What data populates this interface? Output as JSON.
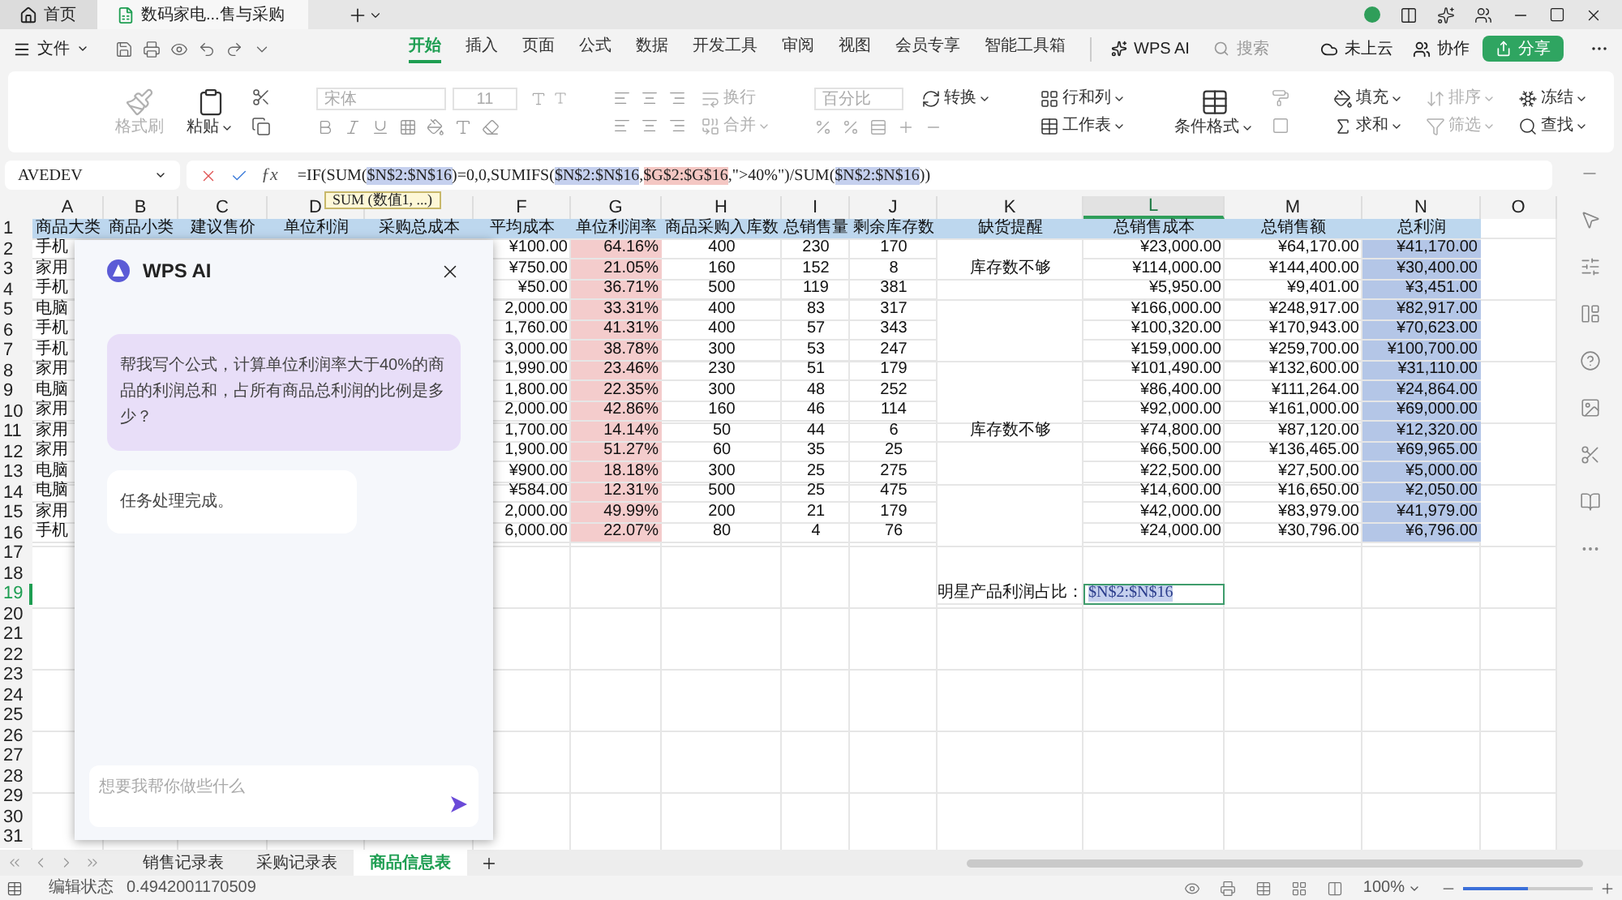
{
  "doc_tabs": [
    {
      "label": "首页",
      "kind": "home",
      "selected": false
    },
    {
      "label": "数码家电...售与采购",
      "kind": "sheet",
      "selected": true
    }
  ],
  "menu": {
    "file": "文件",
    "tabs": [
      {
        "label": "开始",
        "selected": true
      },
      {
        "label": "插入",
        "selected": false
      },
      {
        "label": "页面",
        "selected": false
      },
      {
        "label": "公式",
        "selected": false
      },
      {
        "label": "数据",
        "selected": false
      },
      {
        "label": "开发工具",
        "selected": false
      },
      {
        "label": "审阅",
        "selected": false
      },
      {
        "label": "视图",
        "selected": false
      },
      {
        "label": "会员专享",
        "selected": false
      },
      {
        "label": "智能工具箱",
        "selected": false
      }
    ],
    "ai": "WPS AI",
    "search": {
      "placeholder": "搜索"
    },
    "cloud": "未上云",
    "collab": "协作",
    "share": "分享"
  },
  "ribbon": {
    "format_painter": {
      "label": "格式刷",
      "disabled": true
    },
    "paste": {
      "label": "粘贴",
      "disabled": false
    },
    "font": {
      "label": "宋体",
      "disabled": true
    },
    "font_size": {
      "label": "11",
      "disabled": true
    },
    "wrap": {
      "label": "换行",
      "disabled": true
    },
    "merge": {
      "label": "合并",
      "disabled": true
    },
    "number_format": {
      "label": "百分比",
      "disabled": true
    },
    "convert": {
      "label": "转换",
      "disabled": false
    },
    "rows_cols": {
      "label": "行和列",
      "disabled": false
    },
    "worksheet": {
      "label": "工作表",
      "disabled": false
    },
    "cond_format": {
      "label": "条件格式",
      "disabled": false
    },
    "fill": {
      "label": "填充",
      "disabled": false
    },
    "sort": {
      "label": "排序",
      "disabled": true
    },
    "freeze": {
      "label": "冻结",
      "disabled": false
    },
    "sum": {
      "label": "求和",
      "disabled": false
    },
    "filter": {
      "label": "筛选",
      "disabled": true
    },
    "find": {
      "label": "查找",
      "disabled": false
    }
  },
  "formula_bar": {
    "name_box": "AVEDEV",
    "fx": "ƒx",
    "parts": [
      {
        "text": "=IF(SUM("
      },
      {
        "text": "$N$2:$N$16",
        "color": "#c5d0ee"
      },
      {
        "text": ")=0,0,SUMIFS("
      },
      {
        "text": "$N$2:$N$16",
        "color": "#c5d0ee"
      },
      {
        "text": ","
      },
      {
        "text": "$G$2:$G$16",
        "color": "#f4c7c3"
      },
      {
        "text": ",\">40%\")/SUM("
      },
      {
        "text": "$N$2:$N$16",
        "color": "#c5d0ee"
      },
      {
        "text": "))"
      }
    ]
  },
  "tooltip": "SUM (数值1, ...)",
  "columns": [
    {
      "label": "A",
      "selected": false
    },
    {
      "label": "B",
      "selected": false
    },
    {
      "label": "C",
      "selected": false
    },
    {
      "label": "D",
      "selected": false
    },
    {
      "selected": false
    },
    {
      "label": "F",
      "selected": false
    },
    {
      "label": "G",
      "selected": false,
      "color": "#f4cccc"
    },
    {
      "label": "H",
      "selected": false
    },
    {
      "label": "I",
      "selected": false
    },
    {
      "label": "J",
      "selected": false
    },
    {
      "label": "K",
      "selected": false
    },
    {
      "label": "L",
      "selected": true
    },
    {
      "label": "M",
      "selected": false
    },
    {
      "label": "N",
      "selected": false,
      "color": "#b4c6e7"
    },
    {
      "label": "O",
      "selected": false
    }
  ],
  "rows": [
    {
      "number": "1",
      "selected": false,
      "color": "#bdd7ee",
      "cells": {
        "A": "商品大类",
        "B": "商品小类",
        "C": "建议售价",
        "D": "单位利润",
        "E": "采购总成本",
        "F": "平均成本",
        "G": "单位利润率",
        "H": "商品采购入库数",
        "I": "总销售量",
        "J": "剩余库存数",
        "K": "缺货提醒",
        "L": "总销售成本",
        "M": "总销售额",
        "N": "总利润"
      }
    },
    {
      "number": "2",
      "selected": false,
      "cells": {
        "A": "手机",
        "F": "¥100.00",
        "G": "64.16%",
        "H": "400",
        "I": "230",
        "J": "170",
        "L": "¥23,000.00",
        "M": "¥64,170.00",
        "N": "¥41,170.00"
      }
    },
    {
      "number": "3",
      "selected": false,
      "cells": {
        "A": "家用",
        "F": "¥750.00",
        "G": "21.05%",
        "H": "160",
        "I": "152",
        "J": "8",
        "K": "库存数不够",
        "L": "¥114,000.00",
        "M": "¥144,400.00",
        "N": "¥30,400.00"
      }
    },
    {
      "number": "4",
      "selected": false,
      "cells": {
        "A": "手机",
        "F": "¥50.00",
        "G": "36.71%",
        "H": "500",
        "I": "119",
        "J": "381",
        "L": "¥5,950.00",
        "M": "¥9,401.00",
        "N": "¥3,451.00"
      }
    },
    {
      "number": "5",
      "selected": false,
      "cells": {
        "A": "电脑",
        "F": "2,000.00",
        "G": "33.31%",
        "H": "400",
        "I": "83",
        "J": "317",
        "L": "¥166,000.00",
        "M": "¥248,917.00",
        "N": "¥82,917.00"
      }
    },
    {
      "number": "6",
      "selected": false,
      "cells": {
        "A": "手机",
        "F": "1,760.00",
        "G": "41.31%",
        "H": "400",
        "I": "57",
        "J": "343",
        "L": "¥100,320.00",
        "M": "¥170,943.00",
        "N": "¥70,623.00"
      }
    },
    {
      "number": "7",
      "selected": false,
      "cells": {
        "A": "手机",
        "F": "3,000.00",
        "G": "38.78%",
        "H": "300",
        "I": "53",
        "J": "247",
        "L": "¥159,000.00",
        "M": "¥259,700.00",
        "N": "¥100,700.00"
      }
    },
    {
      "number": "8",
      "selected": false,
      "cells": {
        "A": "家用",
        "F": "1,990.00",
        "G": "23.46%",
        "H": "230",
        "I": "51",
        "J": "179",
        "L": "¥101,490.00",
        "M": "¥132,600.00",
        "N": "¥31,110.00"
      }
    },
    {
      "number": "9",
      "selected": false,
      "cells": {
        "A": "电脑",
        "F": "1,800.00",
        "G": "22.35%",
        "H": "300",
        "I": "48",
        "J": "252",
        "L": "¥86,400.00",
        "M": "¥111,264.00",
        "N": "¥24,864.00"
      }
    },
    {
      "number": "10",
      "selected": false,
      "cells": {
        "A": "家用",
        "F": "2,000.00",
        "G": "42.86%",
        "H": "160",
        "I": "46",
        "J": "114",
        "L": "¥92,000.00",
        "M": "¥161,000.00",
        "N": "¥69,000.00"
      }
    },
    {
      "number": "11",
      "selected": false,
      "cells": {
        "A": "家用",
        "F": "1,700.00",
        "G": "14.14%",
        "H": "50",
        "I": "44",
        "J": "6",
        "K": "库存数不够",
        "L": "¥74,800.00",
        "M": "¥87,120.00",
        "N": "¥12,320.00"
      }
    },
    {
      "number": "12",
      "selected": false,
      "cells": {
        "A": "家用",
        "F": "1,900.00",
        "G": "51.27%",
        "H": "60",
        "I": "35",
        "J": "25",
        "L": "¥66,500.00",
        "M": "¥136,465.00",
        "N": "¥69,965.00"
      }
    },
    {
      "number": "13",
      "selected": false,
      "cells": {
        "A": "电脑",
        "F": "¥900.00",
        "G": "18.18%",
        "H": "300",
        "I": "25",
        "J": "275",
        "L": "¥22,500.00",
        "M": "¥27,500.00",
        "N": "¥5,000.00"
      }
    },
    {
      "number": "14",
      "selected": false,
      "cells": {
        "A": "电脑",
        "F": "¥584.00",
        "G": "12.31%",
        "H": "500",
        "I": "25",
        "J": "475",
        "L": "¥14,600.00",
        "M": "¥16,650.00",
        "N": "¥2,050.00"
      }
    },
    {
      "number": "15",
      "selected": false,
      "cells": {
        "A": "家用",
        "F": "2,000.00",
        "G": "49.99%",
        "H": "200",
        "I": "21",
        "J": "179",
        "L": "¥42,000.00",
        "M": "¥83,979.00",
        "N": "¥41,979.00"
      }
    },
    {
      "number": "16",
      "selected": false,
      "cells": {
        "A": "手机",
        "F": "6,000.00",
        "G": "22.07%",
        "H": "80",
        "I": "4",
        "J": "76",
        "L": "¥24,000.00",
        "M": "¥30,796.00",
        "N": "¥6,796.00"
      }
    },
    {
      "number": "17",
      "selected": false
    },
    {
      "number": "18",
      "selected": false
    },
    {
      "number": "19",
      "selected": true,
      "cells": {
        "K": "明星产品利润占比：",
        "L": {
          "text": "$N$2:$N$16",
          "color": "#c5d0ee",
          "editing": true
        }
      }
    },
    {
      "number": "20",
      "selected": false
    },
    {
      "number": "21",
      "selected": false
    },
    {
      "number": "22",
      "selected": false
    },
    {
      "number": "23",
      "selected": false
    },
    {
      "number": "24",
      "selected": false
    },
    {
      "number": "25",
      "selected": false
    },
    {
      "number": "26",
      "selected": false
    },
    {
      "number": "27",
      "selected": false
    },
    {
      "number": "28",
      "selected": false
    },
    {
      "number": "29",
      "selected": false
    },
    {
      "number": "30",
      "selected": false
    },
    {
      "number": "31",
      "selected": false
    }
  ],
  "ai_panel": {
    "title": "WPS AI",
    "messages": [
      {
        "kind": "user",
        "text": "帮我写个公式，计算单位利润率大于40%的商品的利润总和，占所有商品总利润的比例是多少？"
      },
      {
        "kind": "assistant",
        "text": "任务处理完成。"
      }
    ],
    "input": {
      "placeholder": "想要我帮你做些什么"
    }
  },
  "sheet_tabs": [
    {
      "label": "销售记录表",
      "selected": false
    },
    {
      "label": "采购记录表",
      "selected": false
    },
    {
      "label": "商品信息表",
      "selected": true
    }
  ],
  "status_bar": {
    "mode": "编辑状态",
    "value": "0.4942001170509",
    "zoom": "100%",
    "zoom_slider": {
      "level": 0.5
    }
  }
}
